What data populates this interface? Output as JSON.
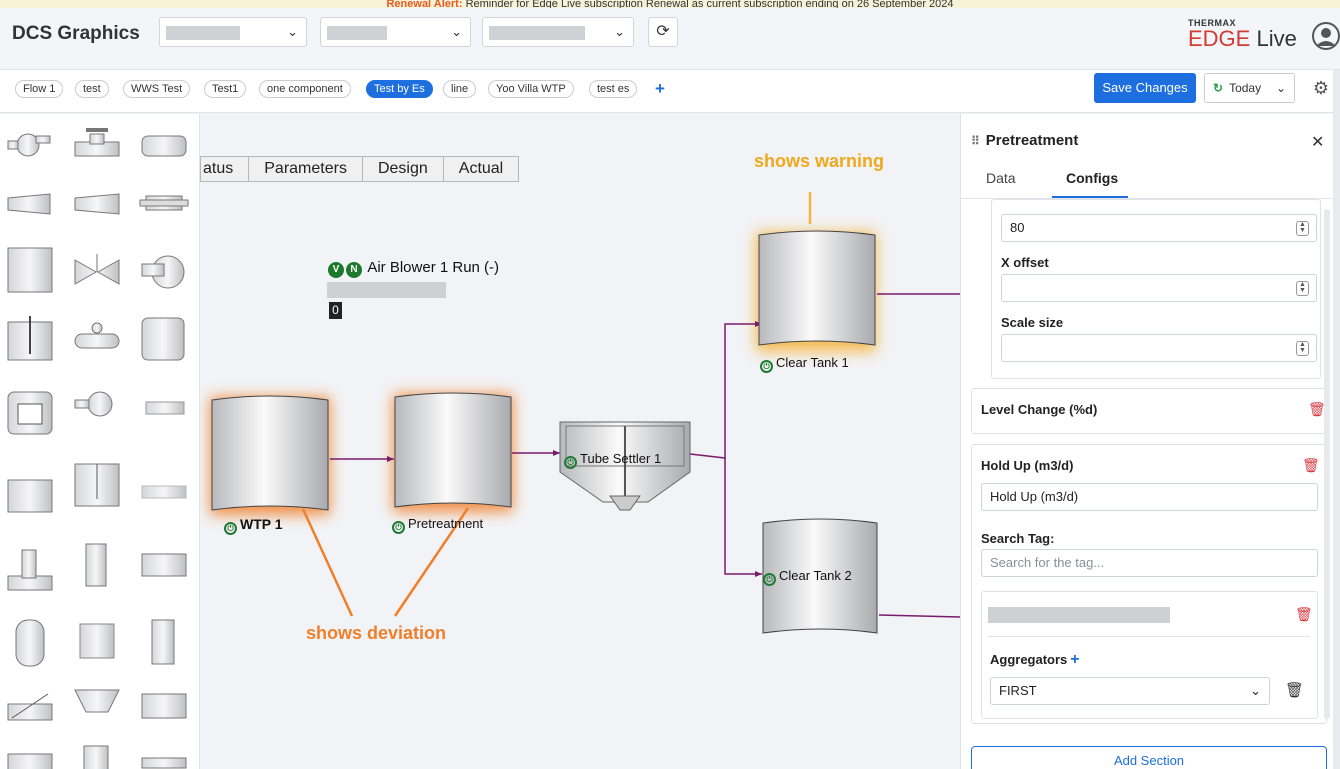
{
  "alert": {
    "prefix": "Renewal Alert:",
    "message": "Reminder for Edge Live subscription Renewal as current subscription ending on 26 September 2024"
  },
  "header": {
    "title": "DCS Graphics",
    "brand_small": "THERMAX",
    "brand_edge": "EDGE",
    "brand_live": "Live"
  },
  "tabs": [
    "Flow 1",
    "test",
    "WWS Test",
    "Test1",
    "one component",
    "Test by Es",
    "line",
    "Yoo Villa WTP",
    "test es"
  ],
  "active_tab": "Test by Es",
  "toolbar": {
    "save_label": "Save Changes",
    "date_label": "Today"
  },
  "canvas": {
    "table_headers": [
      "atus",
      "Parameters",
      "Design",
      "Actual"
    ],
    "annotation_warning": "shows warning",
    "annotation_deviation": "shows deviation",
    "air_blower_label": "Air Blower 1 Run (-)",
    "badge_v": "V",
    "badge_n": "N",
    "air_blower_value": "0",
    "components": {
      "wtp1": "WTP 1",
      "pretreatment": "Pretreatment",
      "tube_settler": "Tube Settler 1",
      "clear_tank_1": "Clear Tank 1",
      "clear_tank_2": "Clear Tank 2"
    }
  },
  "panel": {
    "title": "Pretreatment",
    "tabs": {
      "data": "Data",
      "configs": "Configs"
    },
    "active_tab": "Configs",
    "y_offset_value": "80",
    "x_offset_label": "X offset",
    "x_offset_value": "",
    "scale_label": "Scale size",
    "scale_value": "",
    "section_level_change": "Level Change (%d)",
    "section_hold_up": "Hold Up (m3/d)",
    "hold_up_value": "Hold Up (m3/d)",
    "search_tag_label": "Search Tag:",
    "search_tag_placeholder": "Search for the tag...",
    "aggregators_label": "Aggregators",
    "aggregator_value": "FIRST",
    "add_section_label": "Add Section"
  },
  "colors": {
    "primary": "#1d6fe0",
    "warning_glow": "#f5b43c",
    "deviation_glow": "#f07f2a",
    "pipe": "#7a1a6b",
    "status_green": "#1f7a33"
  }
}
